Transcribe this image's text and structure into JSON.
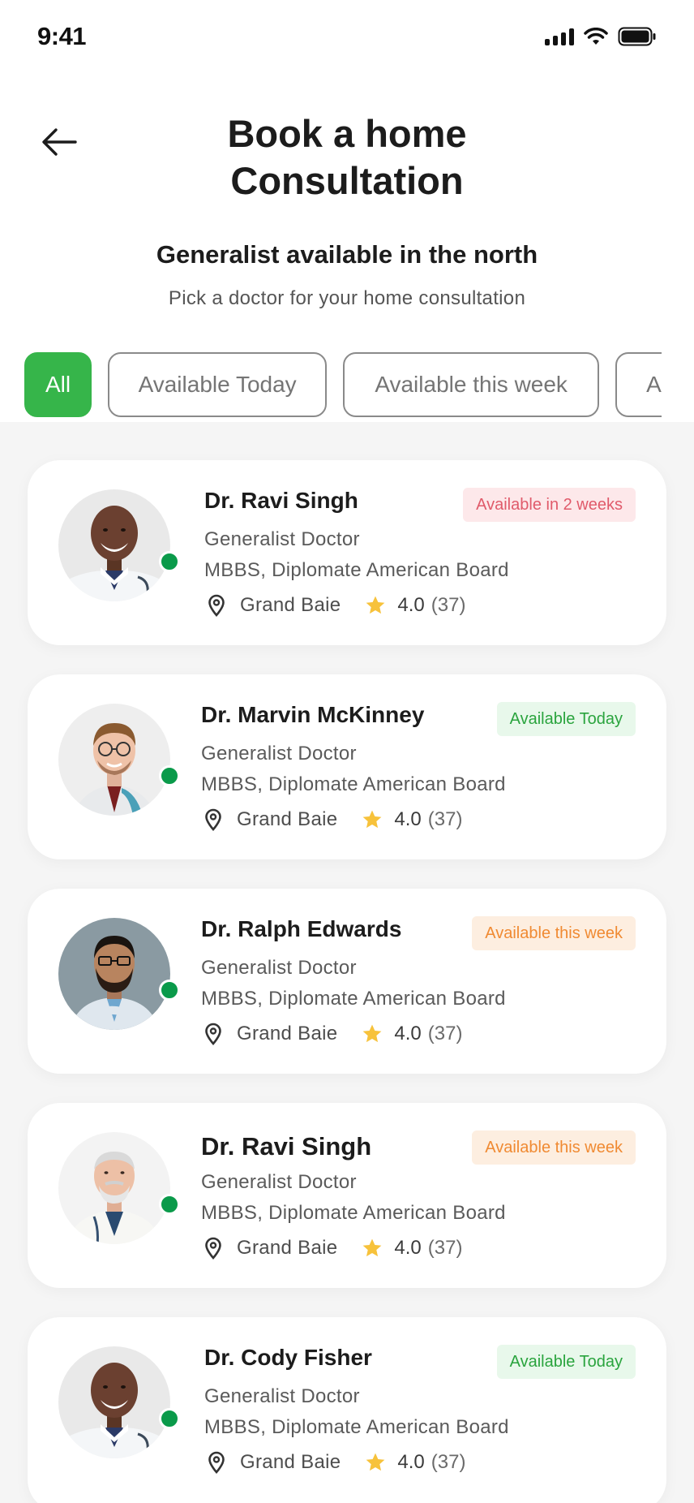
{
  "status_bar": {
    "time": "9:41"
  },
  "header": {
    "title_line1": "Book a home",
    "title_line2": "Consultation"
  },
  "section": {
    "title": "Generalist available in the north",
    "subtitle": "Pick a doctor for your home consultation"
  },
  "filters": [
    {
      "label": "All",
      "active": true
    },
    {
      "label": "Available Today",
      "active": false
    },
    {
      "label": "Available this week",
      "active": false
    },
    {
      "label": "A",
      "active": false
    }
  ],
  "doctors": [
    {
      "name": "Dr. Ravi Singh",
      "specialty": "Generalist Doctor",
      "qualification": "MBBS, Diplomate American Board",
      "location": "Grand Baie",
      "rating": "4.0",
      "reviews": "(37)",
      "availability": "Available in 2 weeks",
      "availability_status": "red",
      "online": true
    },
    {
      "name": "Dr. Marvin McKinney",
      "specialty": "Generalist Doctor",
      "qualification": "MBBS, Diplomate American Board",
      "location": "Grand Baie",
      "rating": "4.0",
      "reviews": "(37)",
      "availability": "Available Today",
      "availability_status": "green",
      "online": true
    },
    {
      "name": "Dr. Ralph Edwards",
      "specialty": "Generalist Doctor",
      "qualification": "MBBS, Diplomate American Board",
      "location": "Grand Baie",
      "rating": "4.0",
      "reviews": "(37)",
      "availability": "Available this week",
      "availability_status": "orange",
      "online": true
    },
    {
      "name": "Dr. Ravi Singh",
      "specialty": "Generalist Doctor",
      "qualification": "MBBS, Diplomate American Board",
      "location": "Grand Baie",
      "rating": "4.0",
      "reviews": "(37)",
      "availability": "Available this week",
      "availability_status": "orange",
      "online": true
    },
    {
      "name": "Dr. Cody Fisher",
      "specialty": "Generalist Doctor",
      "qualification": "MBBS, Diplomate American Board",
      "location": "Grand Baie",
      "rating": "4.0",
      "reviews": "(37)",
      "availability": "Available Today",
      "availability_status": "green",
      "online": true
    }
  ],
  "colors": {
    "accent": "#36b54a",
    "online": "#0a9a4a",
    "star": "#f7c23b"
  }
}
